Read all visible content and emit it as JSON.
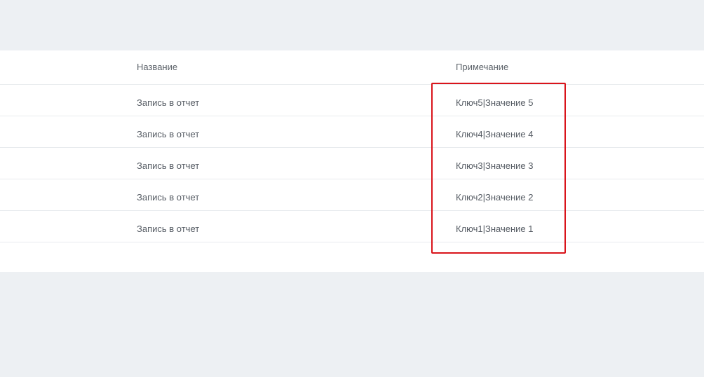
{
  "table": {
    "headers": {
      "name": "Название",
      "note": "Примечание"
    },
    "rows": [
      {
        "name": "Запись в отчет",
        "note": "Ключ5|Значение 5"
      },
      {
        "name": "Запись в отчет",
        "note": "Ключ4|Значение 4"
      },
      {
        "name": "Запись в отчет",
        "note": "Ключ3|Значение 3"
      },
      {
        "name": "Запись в отчет",
        "note": "Ключ2|Значение 2"
      },
      {
        "name": "Запись в отчет",
        "note": "Ключ1|Значение 1"
      }
    ]
  },
  "colors": {
    "background": "#edf0f3",
    "panel": "#ffffff",
    "text": "#555b63",
    "highlight_border": "#d9141b"
  }
}
